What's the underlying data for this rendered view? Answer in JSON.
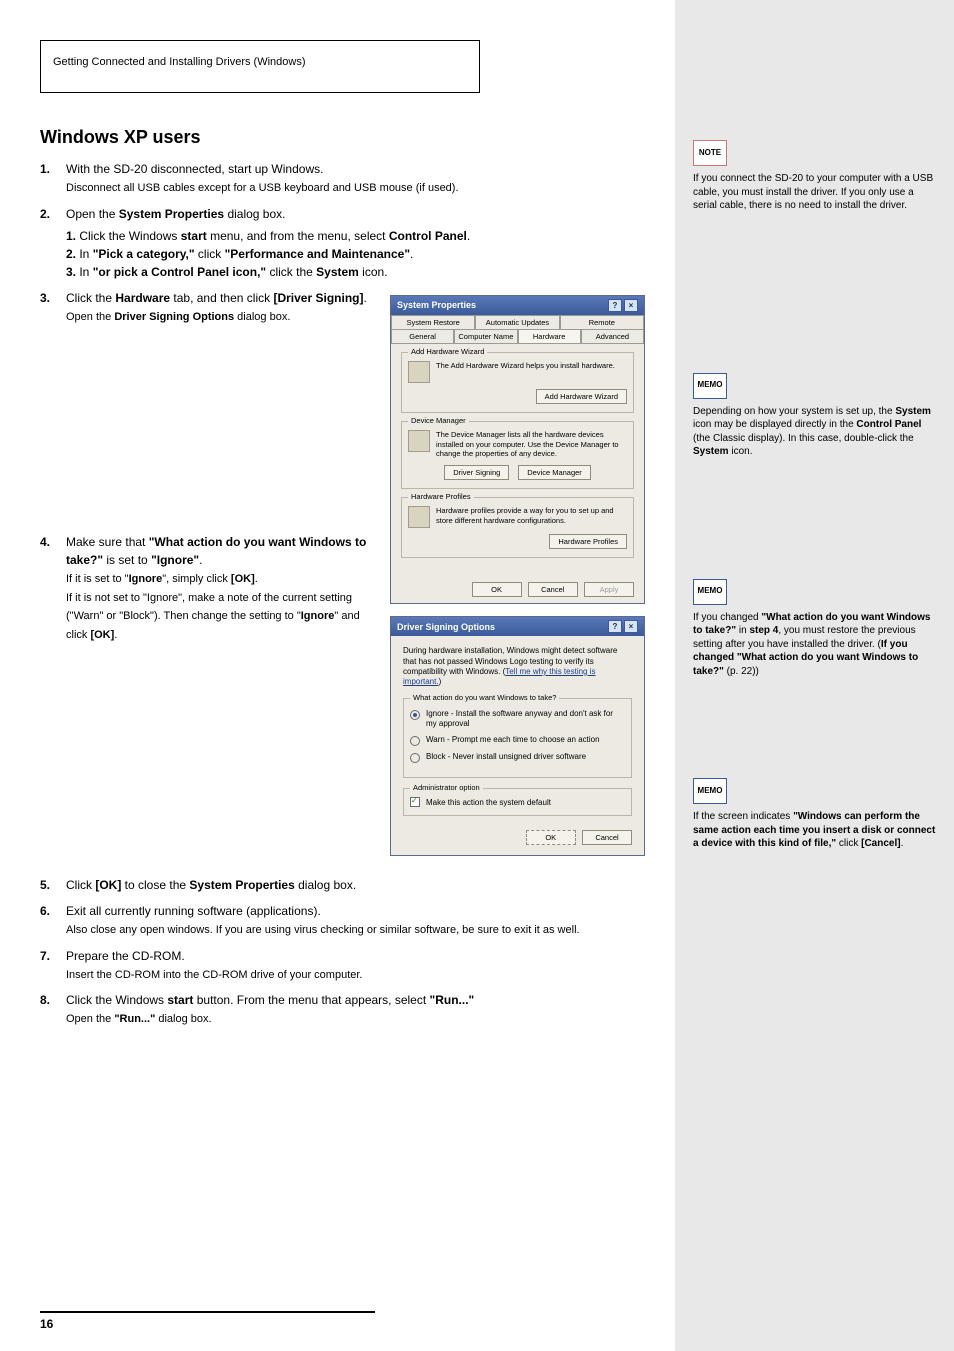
{
  "title_box": "Getting Connected and Installing Drivers (Windows)",
  "section_heading": "Windows XP users",
  "steps_upper": [
    {
      "n": "1.",
      "txt": "With the SD-20 disconnected, start up Windows.",
      "note": "Disconnect all USB cables except for a USB keyboard and USB mouse (if used)."
    },
    {
      "n": "2.",
      "txt": "Open the ",
      "b": "System Properties",
      "after": " dialog box.",
      "lines": [
        "Click the Windows <b>start</b> menu, and from the menu, select <b>Control Panel</b>.",
        "In <b>\"Pick a category,\"</b> click <b>\"Performance and Maintenance\"</b>.",
        "In <b>\"or pick a Control Panel icon,\"</b> click the <b>System</b> icon."
      ],
      "sub": [
        "1.",
        "2.",
        "3."
      ]
    },
    {
      "n": "3.",
      "txt": "Click the ",
      "b": "Hardware",
      "after": " tab, and then click ",
      "b2": "[Driver Signing]",
      "after2": ".",
      "extra": "Open the <b>Driver Signing Options</b> dialog box."
    },
    {
      "n": "4.",
      "txt": "Make sure that ",
      "b": "\"What action do you want Windows to take?\"",
      "after": " is set to ",
      "b2": "\"Ignore\"",
      "after2": ".",
      "extra": "If it is set to \"<b>Ignore</b>\", simply click <b>[OK]</b>.<br>If it is not set to \"Ignore\", make a note of the current setting (\"Warn\" or \"Block\"). Then change the setting to \"<b>Ignore</b>\" and click <b>[OK]</b>."
    }
  ],
  "steps_lower": [
    {
      "n": "5.",
      "txt": "Click <b>[OK]</b> to close the <b>System Properties</b> dialog box."
    },
    {
      "n": "6.",
      "txt": "Exit all currently running software (applications).",
      "extra": "Also close any open windows. If you are using virus checking or similar software, be sure to exit it as well."
    },
    {
      "n": "7.",
      "txt": "Prepare the CD-ROM.",
      "extra": "Insert the CD-ROM into the CD-ROM drive of your computer."
    },
    {
      "n": "8.",
      "txt": "Click the Windows <b>start</b> button. From the menu that appears, select <b>\"Run...\"</b>",
      "extra": "Open the <b>\"Run...\"</b> dialog box."
    }
  ],
  "sys_props": {
    "title": "System Properties",
    "tabs_row1": [
      "System Restore",
      "Automatic Updates",
      "Remote"
    ],
    "tabs_row2": [
      "General",
      "Computer Name",
      "Hardware",
      "Advanced"
    ],
    "active_tab": "Hardware",
    "ahw": {
      "title": "Add Hardware Wizard",
      "text": "The Add Hardware Wizard helps you install hardware.",
      "btn": "Add Hardware Wizard"
    },
    "dm": {
      "title": "Device Manager",
      "text": "The Device Manager lists all the hardware devices installed on your computer. Use the Device Manager to change the properties of any device.",
      "btn1": "Driver Signing",
      "btn2": "Device Manager"
    },
    "hp": {
      "title": "Hardware Profiles",
      "text": "Hardware profiles provide a way for you to set up and store different hardware configurations.",
      "btn": "Hardware Profiles"
    },
    "footer": {
      "ok": "OK",
      "cancel": "Cancel",
      "apply": "Apply"
    }
  },
  "driver_dlg": {
    "title": "Driver Signing Options",
    "intro": "During hardware installation, Windows might detect software that has not passed Windows Logo testing to verify its compatibility with Windows. (",
    "intro_link": "Tell me why this testing is important.",
    "intro_after": ")",
    "q": "What action do you want Windows to take?",
    "opt1": "Ignore - Install the software anyway and don't ask for my approval",
    "opt2": "Warn - Prompt me each time to choose an action",
    "opt3": "Block - Never install unsigned driver software",
    "admin_title": "Administrator option",
    "admin_chk": "Make this action the system default",
    "ok": "OK",
    "cancel": "Cancel"
  },
  "sidebar": {
    "note": {
      "label": "NOTE",
      "text": "If you connect the SD-20 to your computer with a USB cable, you must install the driver. If you only use a serial cable, there is no need to install the driver."
    },
    "memo1": {
      "label": "MEMO",
      "text": "Depending on how your system is set up, the <b>System</b> icon may be displayed directly in the <b>Control Panel</b> (the Classic display). In this case, double-click the <b>System</b> icon."
    },
    "memo2": {
      "label": "MEMO",
      "text": "If you changed <b>\"What action do you want Windows to take?\"</b> in <b>step 4</b>, you must restore the previous setting after you have installed the driver. (<b>If you changed \"What action do you want Windows to take?\"</b> (p. 22))"
    },
    "memo3": {
      "label": "MEMO",
      "text": "If the screen indicates <b>\"Windows can perform the same action each time you insert a disk or connect a device with this kind of file,\"</b> click <b>[Cancel]</b>."
    }
  },
  "page_number": "16"
}
